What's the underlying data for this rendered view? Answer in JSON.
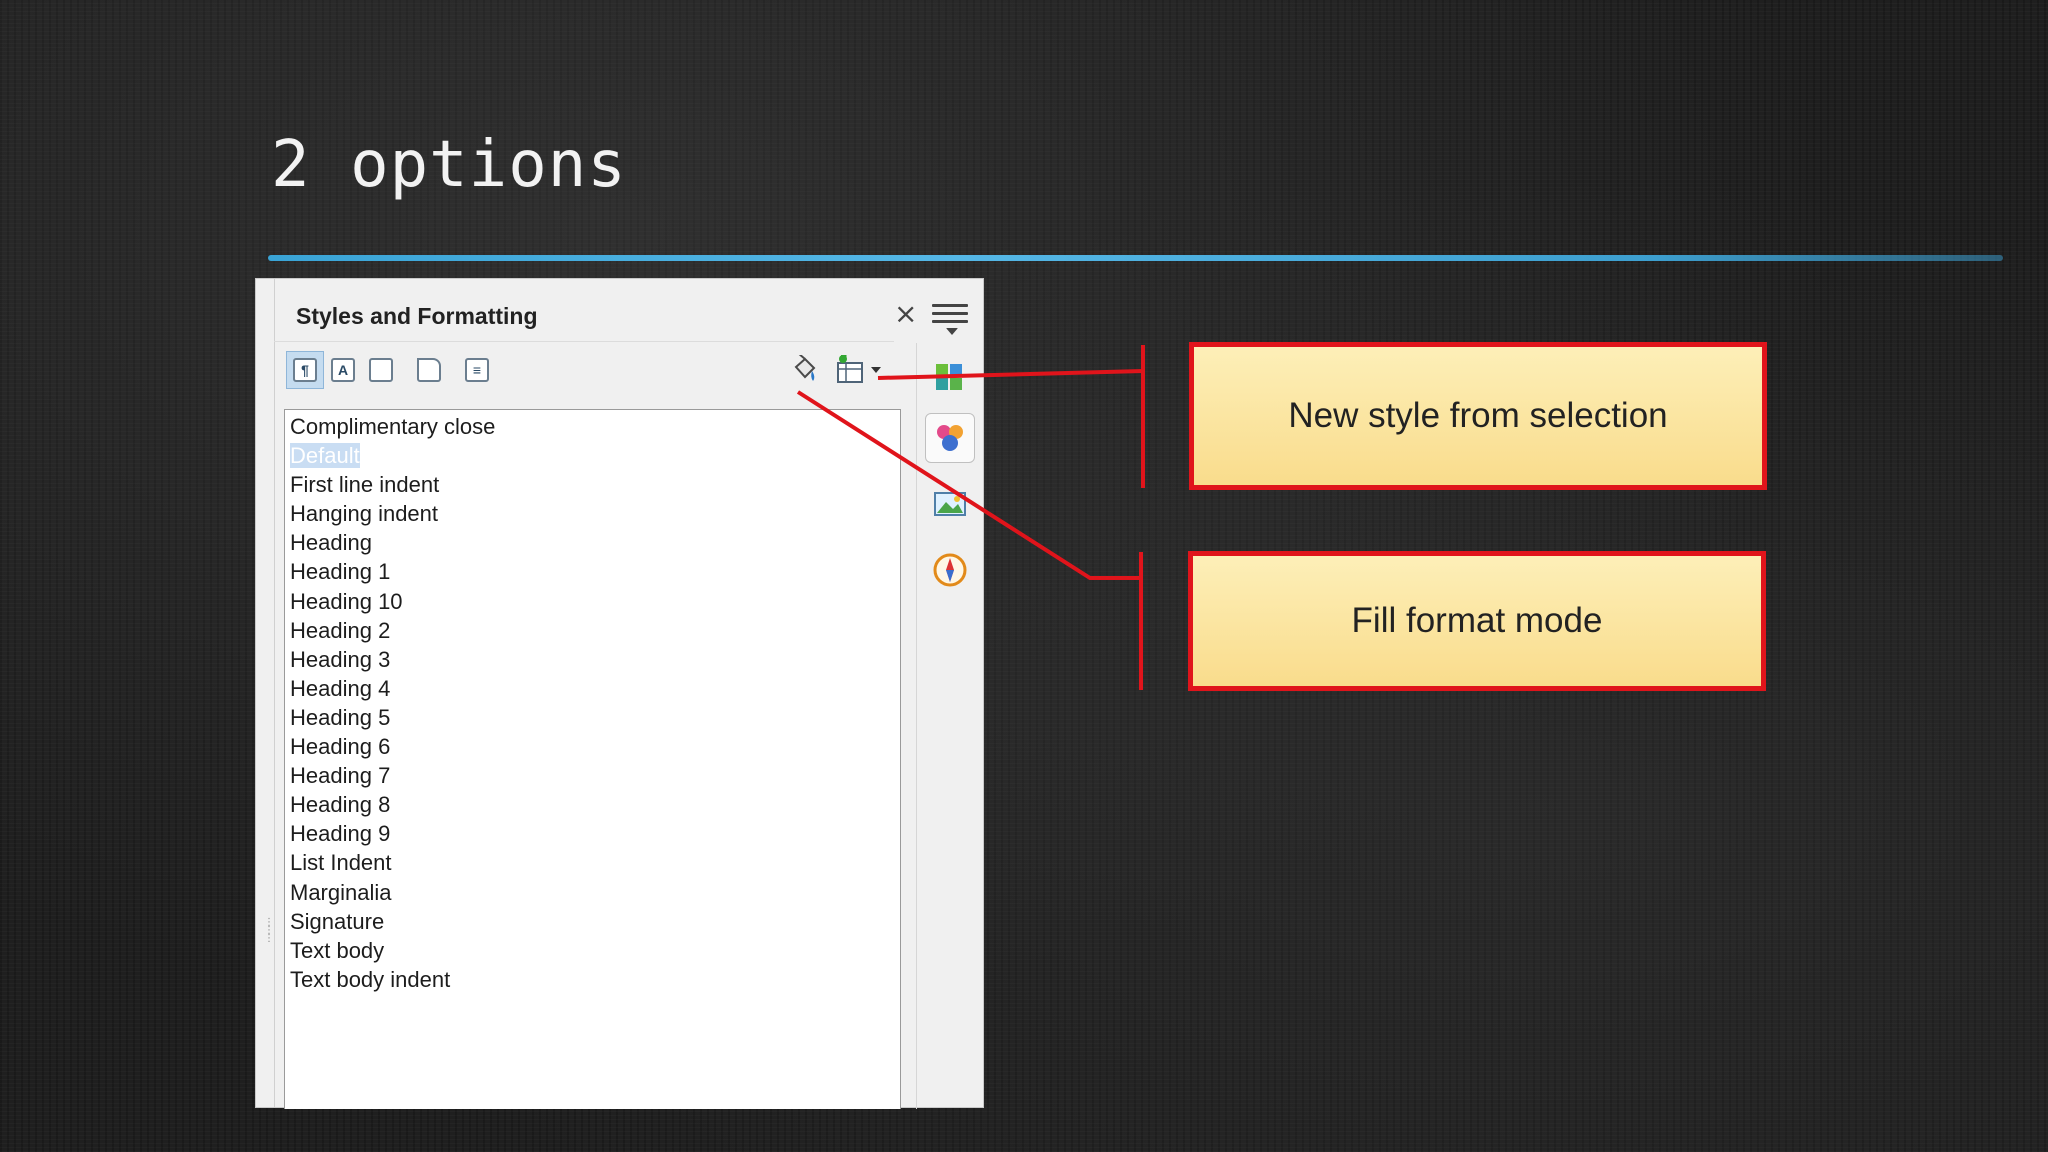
{
  "slide": {
    "title": "2 options"
  },
  "panel": {
    "title": "Styles and Formatting",
    "close_glyph": "×",
    "toolbar": [
      {
        "icon": "paragraph-styles-icon",
        "glyph": "¶",
        "active": true
      },
      {
        "icon": "character-styles-icon",
        "glyph": "A",
        "active": false
      },
      {
        "icon": "frame-styles-icon",
        "glyph": "",
        "active": false
      },
      {
        "icon": "page-styles-icon",
        "glyph": "",
        "active": false
      },
      {
        "icon": "list-styles-icon",
        "glyph": "≡",
        "active": false
      }
    ],
    "actions": [
      {
        "icon": "fill-format-mode-icon"
      },
      {
        "icon": "new-style-from-selection-icon"
      },
      {
        "icon": "dropdown-arrow-icon"
      }
    ],
    "styles": [
      "Complimentary close",
      "Default",
      "First line indent",
      "Hanging indent",
      "Heading",
      "Heading 1",
      "Heading 10",
      "Heading 2",
      "Heading 3",
      "Heading 4",
      "Heading 5",
      "Heading 6",
      "Heading 7",
      "Heading 8",
      "Heading 9",
      "List Indent",
      "Marginalia",
      "Signature",
      "Text body",
      "Text body indent"
    ],
    "selected_style": "Default",
    "sidebar_tabs": [
      "gallery-icon",
      "styles-icon",
      "image-icon",
      "navigator-icon"
    ]
  },
  "callouts": {
    "new_style": "New style from selection",
    "fill_format": "Fill format mode"
  },
  "colors": {
    "accent_rule": "#3aa4d6",
    "callout_border": "#e0141b",
    "callout_fill": "#fbe5a0"
  }
}
